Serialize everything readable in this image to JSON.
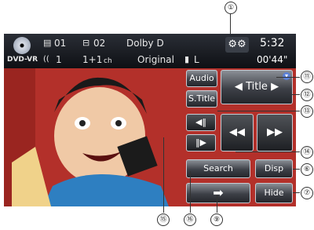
{
  "status": {
    "disc_label": "DVD-VR",
    "title_num": "01",
    "chapter_num": "02",
    "audio_format": "Dolby D",
    "audio_stream": "1",
    "channels": "1+1",
    "channels_unit": "ch",
    "mode": "Original",
    "subtitle_lang": "L",
    "clock": "5:32",
    "elapsed": "00'44\""
  },
  "buttons": {
    "audio": "Audio",
    "title": "Title",
    "s_title": "S.Title",
    "search": "Search",
    "disp": "Disp",
    "hide": "Hide"
  },
  "callouts": {
    "c1": "①",
    "c11": "⑪",
    "c12": "⑫",
    "c13": "⑬",
    "c14": "⑭",
    "c6": "⑥",
    "c7": "⑦",
    "c15": "⑮",
    "c16": "⑯",
    "c9": "⑨"
  },
  "colors": {
    "accent_badge": "#5a7fd6",
    "video_bg": "#b3302a"
  }
}
